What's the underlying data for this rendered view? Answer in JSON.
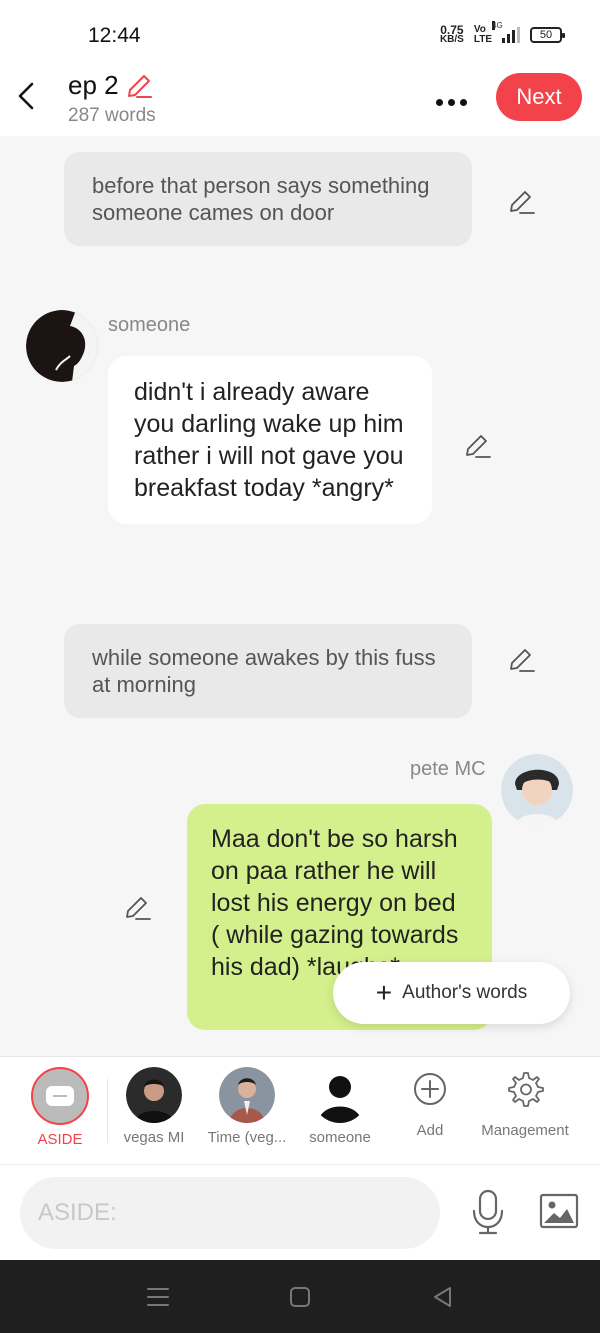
{
  "status": {
    "time": "12:44",
    "netspeed_value": "0.75",
    "netspeed_unit": "KB/S",
    "volte_top": "Vo",
    "volte_bottom": "LTE",
    "network": "4G",
    "battery": "50"
  },
  "header": {
    "title": "ep 2",
    "word_count": "287 words",
    "next_label": "Next"
  },
  "chat": {
    "messages": [
      {
        "type": "aside",
        "text": "before that person says something someone cames on door"
      },
      {
        "type": "character",
        "speaker": "someone",
        "text": "didn't i already aware you darling wake up him rather i will not gave you breakfast today *angry*"
      },
      {
        "type": "aside",
        "text": "while someone awakes by this fuss at morning"
      },
      {
        "type": "character",
        "speaker": "pete MC",
        "text": "Maa don't be so harsh on paa rather he will lost his energy on bed ( while gazing towards his dad) *laughs*"
      }
    ],
    "author_words_label": "Author's words"
  },
  "characters": [
    {
      "label": "ASIDE",
      "selected": true,
      "accent": "#f2434b"
    },
    {
      "label": "vegas MI"
    },
    {
      "label": "Time (veg..."
    },
    {
      "label": "someone"
    },
    {
      "label": "Add",
      "icon": "plus-circle-icon"
    },
    {
      "label": "Management",
      "icon": "gear-icon"
    }
  ],
  "input": {
    "placeholder": "ASIDE:"
  },
  "colors": {
    "accent": "#f2434b",
    "pete_bubble": "#d3f08c",
    "aside_bubble": "#e9e9e9"
  }
}
